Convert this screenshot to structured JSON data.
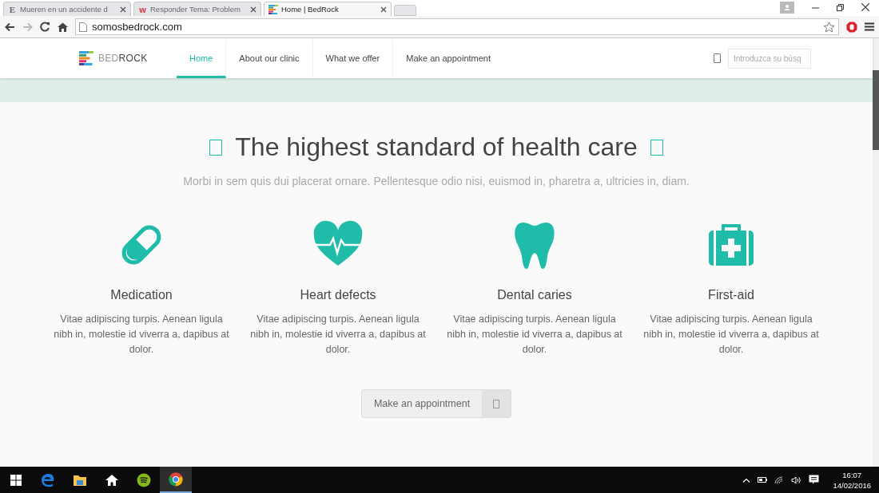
{
  "browser": {
    "tabs": [
      {
        "title": "Mueren en un accidente d",
        "favicon": {
          "kind": "letter",
          "text": "E"
        },
        "selected": false
      },
      {
        "title": "Responder Tema: Problem",
        "favicon": {
          "kind": "letter",
          "text": "w"
        },
        "selected": false
      },
      {
        "title": "Home | BedRock",
        "favicon": {
          "kind": "logo"
        },
        "selected": true
      }
    ],
    "url": "somosbedrock.com"
  },
  "site": {
    "brand": {
      "light": "BED",
      "bold": "ROCK"
    },
    "nav": [
      {
        "label": "Home",
        "selected": true
      },
      {
        "label": "About our clinic",
        "selected": false
      },
      {
        "label": "What we offer",
        "selected": false
      },
      {
        "label": "Make an appointment",
        "selected": false
      }
    ],
    "search": {
      "placeholder": "Introduzca su búsq"
    },
    "heading": "The highest standard of health care",
    "subtitle": "Morbi in sem quis dui placerat ornare. Pellentesque odio nisi, euismod in, pharetra a, ultricies in, diam.",
    "features": [
      {
        "kind": "pill",
        "title": "Medication",
        "text": "Vitae adipiscing turpis. Aenean ligula nibh in, molestie id viverra a, dapibus at dolor."
      },
      {
        "kind": "heart",
        "title": "Heart defects",
        "text": "Vitae adipiscing turpis. Aenean ligula nibh in, molestie id viverra a, dapibus at dolor."
      },
      {
        "kind": "tooth",
        "title": "Dental caries",
        "text": "Vitae adipiscing turpis. Aenean ligula nibh in, molestie id viverra a, dapibus at dolor."
      },
      {
        "kind": "kit",
        "title": "First-aid",
        "text": "Vitae adipiscing turpis. Aenean ligula nibh in, molestie id viverra a, dapibus at dolor."
      }
    ],
    "cta": "Make an appointment"
  },
  "taskbar": {
    "apps": [
      {
        "kind": "edge",
        "active": false
      },
      {
        "kind": "folder",
        "active": false
      },
      {
        "kind": "home",
        "active": false
      },
      {
        "kind": "spotify",
        "active": false
      },
      {
        "kind": "chrome",
        "active": true
      }
    ],
    "time": "16:07",
    "date": "14/02/2016"
  }
}
